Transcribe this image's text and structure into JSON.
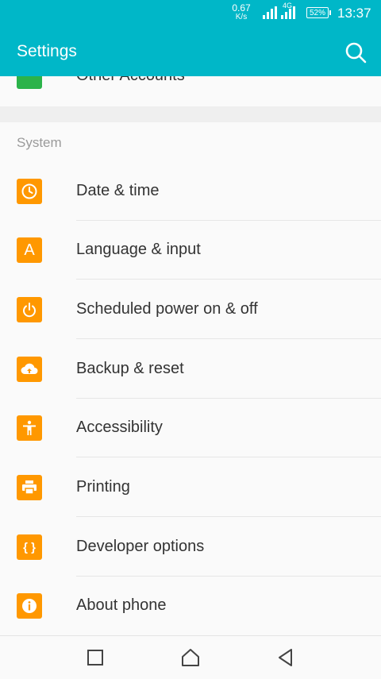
{
  "status_bar": {
    "speed_value": "0.67",
    "speed_unit": "K/s",
    "network_label": "4G",
    "battery": "52%",
    "time": "13:37"
  },
  "app_bar": {
    "title": "Settings",
    "search_icon": "search-icon"
  },
  "partial_item": {
    "label": "Other Accounts",
    "icon": "accounts-icon",
    "icon_color": "#2bb34a"
  },
  "section": {
    "title": "System"
  },
  "items": [
    {
      "label": "Date & time",
      "icon": "clock-icon"
    },
    {
      "label": "Language & input",
      "icon": "language-icon",
      "glyph": "A"
    },
    {
      "label": "Scheduled power on & off",
      "icon": "power-icon"
    },
    {
      "label": "Backup & reset",
      "icon": "cloud-upload-icon"
    },
    {
      "label": "Accessibility",
      "icon": "accessibility-icon"
    },
    {
      "label": "Printing",
      "icon": "printer-icon"
    },
    {
      "label": "Developer options",
      "icon": "braces-icon",
      "glyph": "{ }"
    },
    {
      "label": "About phone",
      "icon": "info-icon",
      "glyph": "i"
    }
  ],
  "nav_bar": {
    "recents": "recents-icon",
    "home": "home-icon",
    "back": "back-icon"
  },
  "colors": {
    "primary": "#00b7c8",
    "icon_orange": "#ff9800"
  }
}
